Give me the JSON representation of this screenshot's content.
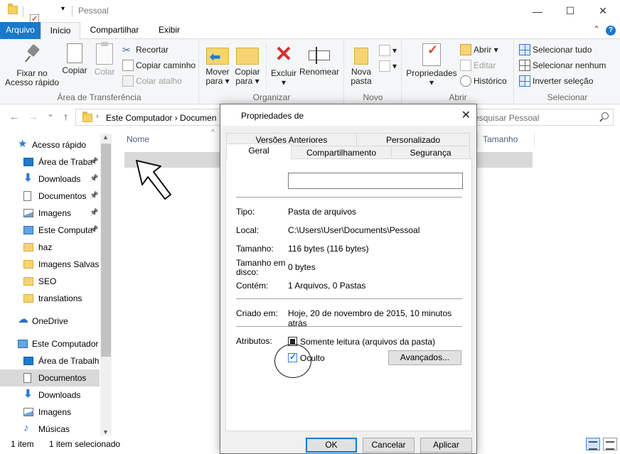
{
  "window": {
    "title": "Pessoal",
    "minimize_glyph": "—",
    "maximize_glyph": "☐",
    "close_glyph": "✕"
  },
  "ribbon_tabs": {
    "arquivo": "Arquivo",
    "inicio": "Início",
    "compartilhar": "Compartilhar",
    "exibir": "Exibir",
    "help": "?",
    "collapse_glyph": "⌃"
  },
  "ribbon": {
    "clipboard": {
      "label": "Área de Transferência",
      "pin_line1": "Fixar no",
      "pin_line2": "Acesso rápido",
      "copy": "Copiar",
      "paste": "Colar",
      "cut": "Recortar",
      "copy_path": "Copiar caminho",
      "paste_shortcut": "Colar atalho"
    },
    "organize": {
      "label": "Organizar",
      "move_line1": "Mover",
      "move_line2": "para ▾",
      "copy_line1": "Copiar",
      "copy_line2": "para ▾",
      "delete_line1": "Excluir",
      "delete_line2": "▾",
      "rename": "Renomear"
    },
    "new": {
      "label": "Novo",
      "new_folder_line1": "Nova",
      "new_folder_line2": "pasta"
    },
    "open": {
      "label": "Abrir",
      "properties_line1": "Propriedades",
      "properties_line2": "▾",
      "open": "Abrir ▾",
      "edit": "Editar",
      "history": "Histórico"
    },
    "select": {
      "label": "Selecionar",
      "select_all": "Selecionar tudo",
      "select_none": "Selecionar nenhum",
      "invert": "Inverter seleção"
    }
  },
  "address": {
    "back": "←",
    "forward": "→",
    "recent": "⌄",
    "up": "↑",
    "path": "Este Computador  ›  Documen",
    "search_placeholder": "esquisar Pessoal"
  },
  "nav_pane": {
    "items": [
      {
        "label": "Acesso rápido",
        "icon": "star-icon",
        "pinned": false
      },
      {
        "label": "Área de Traba",
        "icon": "desktop-icon",
        "pinned": true
      },
      {
        "label": "Downloads",
        "icon": "download-icon",
        "pinned": true
      },
      {
        "label": "Documentos",
        "icon": "document-icon",
        "pinned": true
      },
      {
        "label": "Imagens",
        "icon": "image-icon",
        "pinned": true
      },
      {
        "label": "Este Computa",
        "icon": "computer-icon",
        "pinned": true
      },
      {
        "label": "haz",
        "icon": "folder-icon",
        "pinned": false
      },
      {
        "label": "Imagens Salvas",
        "icon": "folder-icon",
        "pinned": false
      },
      {
        "label": "SEO",
        "icon": "folder-icon",
        "pinned": false
      },
      {
        "label": "translations",
        "icon": "folder-icon",
        "pinned": false
      },
      {
        "label": "OneDrive",
        "icon": "cloud-icon",
        "pinned": false
      },
      {
        "label": "Este Computador",
        "icon": "computer-icon",
        "pinned": false
      },
      {
        "label": "Área de Trabalho",
        "icon": "desktop-icon",
        "pinned": false
      },
      {
        "label": "Documentos",
        "icon": "document-icon",
        "pinned": false,
        "selected": true
      },
      {
        "label": "Downloads",
        "icon": "download-icon",
        "pinned": false
      },
      {
        "label": "Imagens",
        "icon": "image-icon",
        "pinned": false
      },
      {
        "label": "Músicas",
        "icon": "music-icon",
        "pinned": false
      }
    ]
  },
  "file_list": {
    "col_name": "Nome",
    "col_size": "Tamanho",
    "sort_glyph": "^"
  },
  "status": {
    "count": "1 item",
    "selected": "1 item selecionado"
  },
  "dialog": {
    "title": "Propriedades de",
    "close_glyph": "✕",
    "tabs_back": [
      "Versões Anteriores",
      "Personalizado"
    ],
    "tabs_front": [
      "Geral",
      "Compartilhamento",
      "Segurança"
    ],
    "name_value": "",
    "tipo_label": "Tipo:",
    "tipo_value": "Pasta de arquivos",
    "local_label": "Local:",
    "local_value": "C:\\Users\\User\\Documents\\Pessoal",
    "tamanho_label": "Tamanho:",
    "tamanho_value": "116 bytes (116 bytes)",
    "disco_label_line1": "Tamanho em",
    "disco_label_line2": "disco:",
    "disco_value": "0 bytes",
    "contem_label": "Contém:",
    "contem_value": "1 Arquivos, 0 Pastas",
    "criado_label": "Criado em:",
    "criado_value": "Hoje, 20 de novembro de 2015, 10 minutos atrás",
    "atributos_label": "Atributos:",
    "readonly_label": "Somente leitura (arquivos da pasta)",
    "readonly_state": "indeterminate",
    "hidden_label": "Oculto",
    "hidden_checked": true,
    "advanced_button": "Avançados...",
    "ok_button": "OK",
    "cancel_button": "Cancelar",
    "apply_button": "Aplicar"
  }
}
